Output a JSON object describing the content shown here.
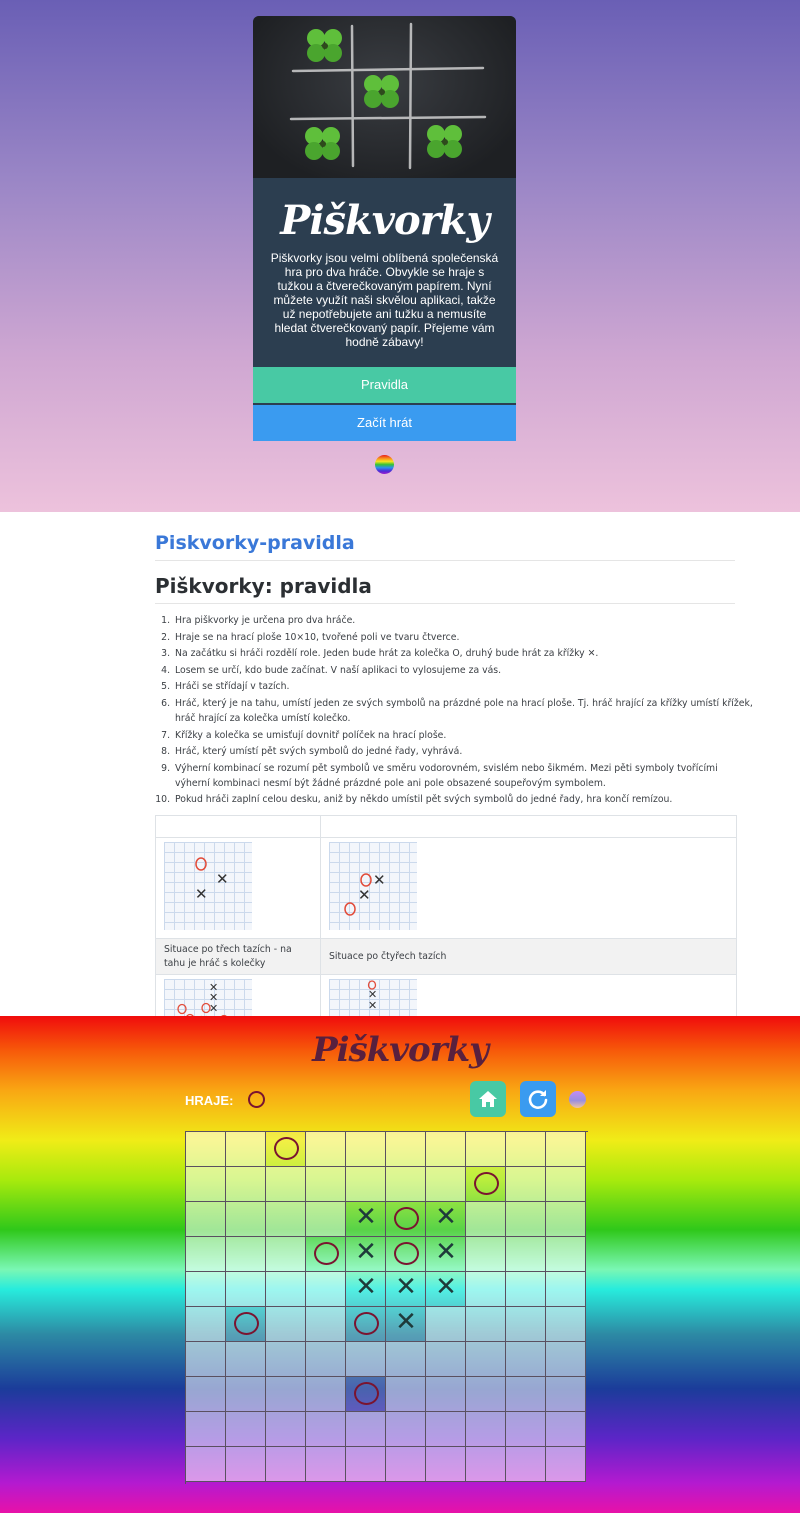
{
  "intro": {
    "title": "Piškvorky",
    "description": "Piškvorky jsou velmi oblíbená společenská hra pro dva hráče. Obvykle se hraje s tužkou a čtverečkovaným papírem. Nyní můžete využít naši skvělou aplikaci, takže už nepotřebujete ani tužku a nemusíte hledat čtverečkovaný papír. Přejeme vám hodně zábavy!",
    "rules_button": "Pravidla",
    "play_button": "Začít hrát",
    "theme_icon": "rainbow-ball-icon"
  },
  "rules": {
    "brand": "Piskvorky-pravidla",
    "heading": "Piškvorky: pravidla",
    "items": [
      "Hra piškvorky je určena pro dva hráče.",
      "Hraje se na hrací ploše 10×10, tvořené poli ve tvaru čtverce.",
      "Na začátku si hráči rozdělí role. Jeden bude hrát za kolečka O, druhý bude hrát za křížky ✕.",
      "Losem se určí, kdo bude začínat. V naší aplikaci to vylosujeme za vás.",
      "Hráči se střídají v tazích.",
      "Hráč, který je na tahu, umístí jeden ze svých symbolů na prázdné pole na hrací ploše. Tj. hráč hrající za křížky umístí křížek, hráč hrající za kolečka umístí kolečko.",
      "Křížky a kolečka se umisťují dovnitř políček na hrací ploše.",
      "Hráč, který umístí pět svých symbolů do jedné řady, vyhrává.",
      "Výherní kombinací se rozumí pět symbolů ve směru vodorovném, svislém nebo šikmém. Mezi pěti symboly tvořícími výherní kombinaci nesmí být žádné prázdné pole ani pole obsazené soupeřovým symbolem.",
      "Pokud hráči zaplní celou desku, aniž by někdo umístil pět svých symbolů do jedné řady, hra končí remízou."
    ],
    "captions": [
      "Situace po třech tazích - na tahu je hráč s kolečky",
      "Situace po čtyřech tazích"
    ]
  },
  "game": {
    "title": "Piškvorky",
    "player_label": "HRAJE:",
    "current_player": "O",
    "home_icon": "home-icon",
    "reset_icon": "reset-icon",
    "theme_icon": "theme-ball-icon",
    "board": [
      [
        "",
        "",
        "O",
        "",
        "",
        "",
        "",
        "",
        "",
        ""
      ],
      [
        "",
        "",
        "",
        "",
        "",
        "",
        "",
        "O",
        "",
        ""
      ],
      [
        "",
        "",
        "",
        "",
        "X",
        "O",
        "X",
        "",
        "",
        ""
      ],
      [
        "",
        "",
        "",
        "O",
        "X",
        "O",
        "X",
        "",
        "",
        ""
      ],
      [
        "",
        "",
        "",
        "",
        "X",
        "X",
        "X",
        "",
        "",
        ""
      ],
      [
        "",
        "O",
        "",
        "",
        "O",
        "X",
        "",
        "",
        "",
        ""
      ],
      [
        "",
        "",
        "",
        "",
        "",
        "",
        "",
        "",
        "",
        ""
      ],
      [
        "",
        "",
        "",
        "",
        "O",
        "",
        "",
        "",
        "",
        ""
      ],
      [
        "",
        "",
        "",
        "",
        "",
        "",
        "",
        "",
        "",
        ""
      ],
      [
        "",
        "",
        "",
        "",
        "",
        "",
        "",
        "",
        "",
        ""
      ]
    ],
    "highlighted": [
      [
        0,
        2
      ],
      [
        1,
        7
      ],
      [
        2,
        4
      ],
      [
        2,
        5
      ],
      [
        2,
        6
      ],
      [
        3,
        3
      ],
      [
        3,
        4
      ],
      [
        3,
        5
      ],
      [
        3,
        6
      ],
      [
        4,
        4
      ],
      [
        4,
        5
      ],
      [
        4,
        6
      ],
      [
        5,
        1
      ],
      [
        5,
        4
      ],
      [
        5,
        5
      ],
      [
        7,
        4
      ]
    ]
  }
}
